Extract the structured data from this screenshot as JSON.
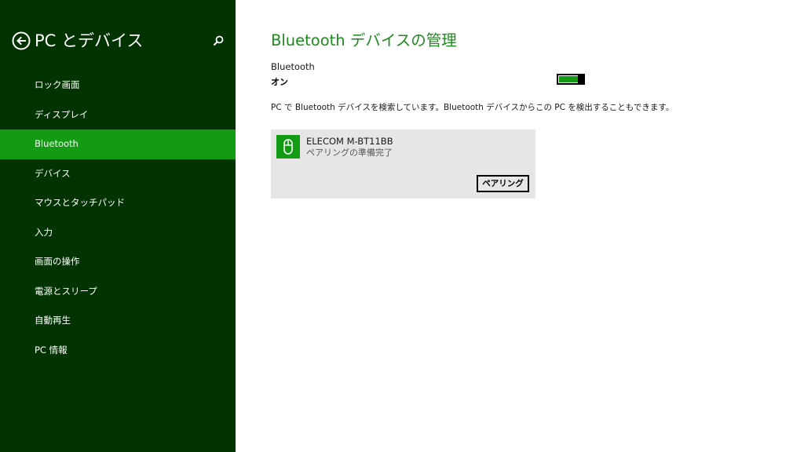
{
  "sidebar": {
    "title": "PC とデバイス",
    "items": [
      {
        "label": "ロック画面",
        "active": false
      },
      {
        "label": "ディスプレイ",
        "active": false
      },
      {
        "label": "Bluetooth",
        "active": true
      },
      {
        "label": "デバイス",
        "active": false
      },
      {
        "label": "マウスとタッチパッド",
        "active": false
      },
      {
        "label": "入力",
        "active": false
      },
      {
        "label": "画面の操作",
        "active": false
      },
      {
        "label": "電源とスリープ",
        "active": false
      },
      {
        "label": "自動再生",
        "active": false
      },
      {
        "label": "PC 情報",
        "active": false
      }
    ]
  },
  "main": {
    "title": "Bluetooth デバイスの管理",
    "bluetooth_label": "Bluetooth",
    "bluetooth_state": "オン",
    "description": "PC で Bluetooth デバイスを検索しています。Bluetooth デバイスからこの PC を検出することもできます。",
    "device": {
      "name": "ELECOM M-BT11BB",
      "status": "ペアリングの準備完了",
      "pair_label": "ペアリング",
      "icon": "mouse-icon"
    }
  },
  "colors": {
    "sidebar_bg": "#003300",
    "accent": "#139b13",
    "title_green": "#1f8a1f",
    "card_bg": "#e6e6e6"
  }
}
